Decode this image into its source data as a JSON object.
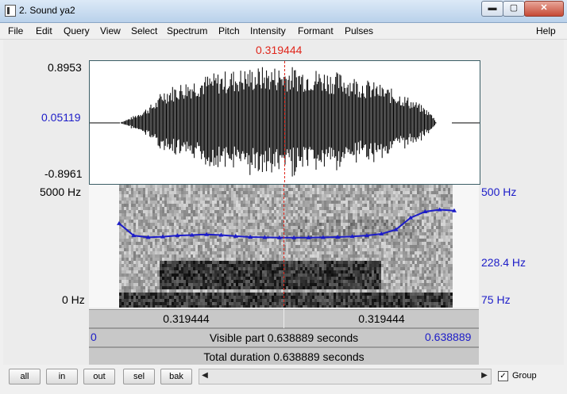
{
  "window": {
    "title": "2. Sound ya2",
    "minimize": "▬",
    "maximize": "▢",
    "close": "✕"
  },
  "menu": [
    "File",
    "Edit",
    "Query",
    "View",
    "Select",
    "Spectrum",
    "Pitch",
    "Intensity",
    "Formant",
    "Pulses",
    "Help"
  ],
  "cursor": {
    "time_label": "0.319444",
    "position_fraction": 0.5,
    "color": "#e0261b"
  },
  "waveform": {
    "max": "0.8953",
    "mid": "0.05119",
    "min": "-0.8961"
  },
  "spectrogram": {
    "freq_top": "5000 Hz",
    "freq_bottom": "0 Hz"
  },
  "pitch": {
    "top": "500 Hz",
    "mid": "228.4 Hz",
    "bottom": "75 Hz",
    "color": "#1c1cc8",
    "contour": [
      275,
      228,
      222,
      224,
      228,
      230,
      232,
      230,
      226,
      223,
      222,
      221,
      221,
      221,
      222,
      223,
      225,
      228,
      234,
      250,
      300,
      330,
      340,
      335
    ],
    "time_range": [
      0.04,
      0.6
    ]
  },
  "bars": {
    "left_time": "0.319444",
    "right_time": "0.319444",
    "visible_start": "0",
    "visible_text": "Visible part 0.638889 seconds",
    "visible_end": "0.638889",
    "total_text": "Total duration 0.638889 seconds"
  },
  "toolbar": {
    "all": "all",
    "in": "in",
    "out": "out",
    "sel": "sel",
    "bak": "bak",
    "group_label": "Group",
    "group_checked": "✓"
  }
}
